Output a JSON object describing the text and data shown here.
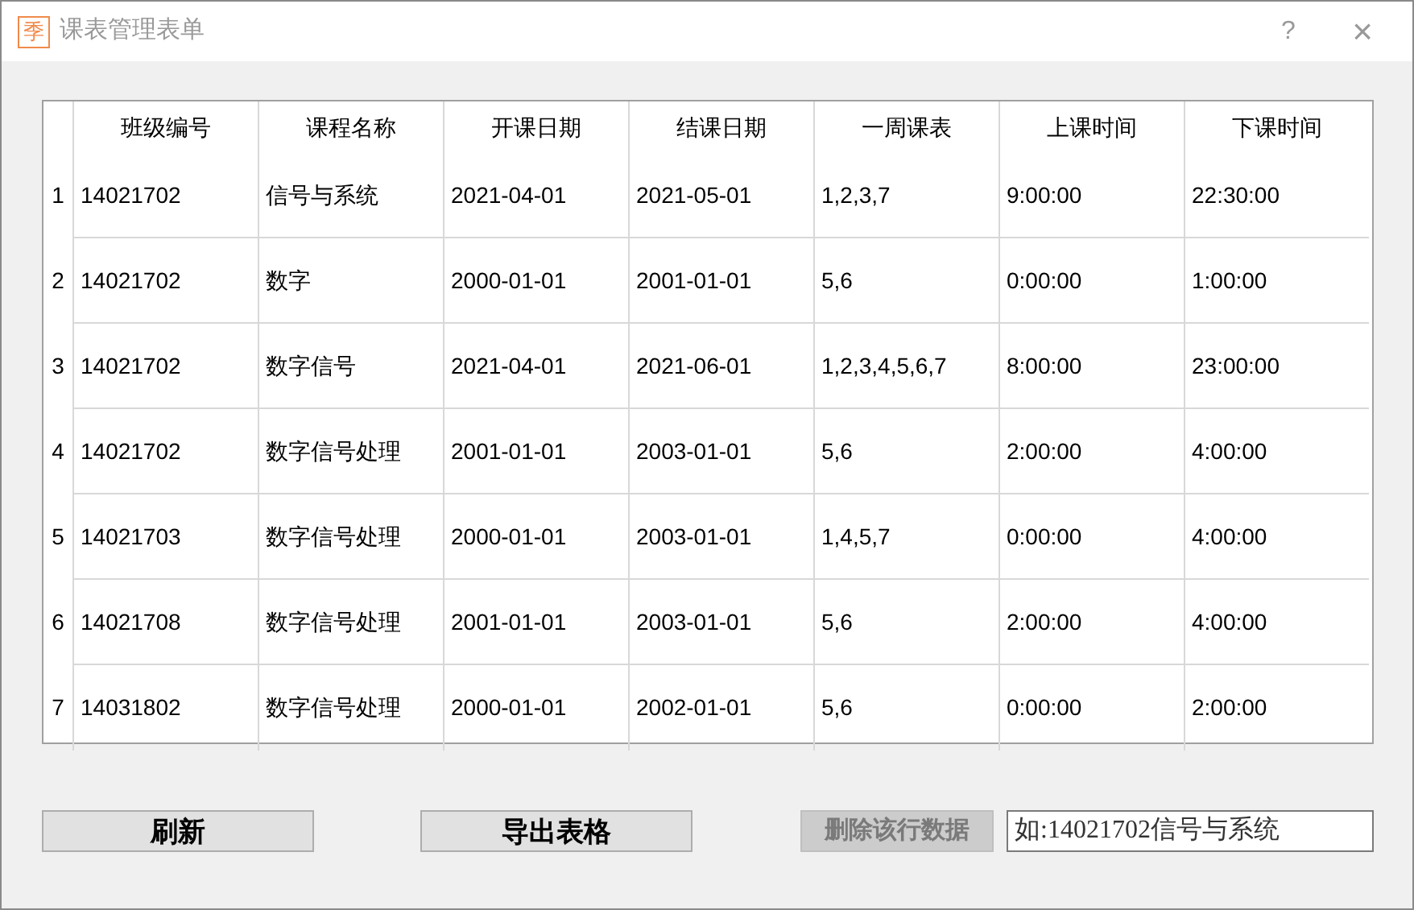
{
  "window": {
    "icon_text": "季",
    "title": "课表管理表单",
    "help": "?",
    "close": "×"
  },
  "table": {
    "columns": [
      "班级编号",
      "课程名称",
      "开课日期",
      "结课日期",
      "一周课表",
      "上课时间",
      "下课时间"
    ],
    "rows": [
      {
        "header": "1",
        "cells": [
          "14021702",
          "信号与系统",
          "2021-04-01",
          "2021-05-01",
          "1,2,3,7",
          "9:00:00",
          "22:30:00"
        ]
      },
      {
        "header": "2",
        "cells": [
          "14021702",
          "数字",
          "2000-01-01",
          "2001-01-01",
          "5,6",
          "0:00:00",
          "1:00:00"
        ]
      },
      {
        "header": "3",
        "cells": [
          "14021702",
          "数字信号",
          "2021-04-01",
          "2021-06-01",
          "1,2,3,4,5,6,7",
          "8:00:00",
          "23:00:00"
        ]
      },
      {
        "header": "4",
        "cells": [
          "14021702",
          "数字信号处理",
          "2001-01-01",
          "2003-01-01",
          "5,6",
          "2:00:00",
          "4:00:00"
        ]
      },
      {
        "header": "5",
        "cells": [
          "14021703",
          "数字信号处理",
          "2000-01-01",
          "2003-01-01",
          "1,4,5,7",
          "0:00:00",
          "4:00:00"
        ]
      },
      {
        "header": "6",
        "cells": [
          "14021708",
          "数字信号处理",
          "2001-01-01",
          "2003-01-01",
          "5,6",
          "2:00:00",
          "4:00:00"
        ]
      },
      {
        "header": "7",
        "cells": [
          "14031802",
          "数字信号处理",
          "2000-01-01",
          "2002-01-01",
          "5,6",
          "0:00:00",
          "2:00:00"
        ]
      }
    ]
  },
  "buttons": [
    {
      "label": "刷新",
      "disabled": false
    },
    {
      "label": "导出表格",
      "disabled": false
    },
    {
      "label": "删除该行数据",
      "disabled": true
    }
  ],
  "search": {
    "placeholder": "如:14021702信号与系统"
  }
}
